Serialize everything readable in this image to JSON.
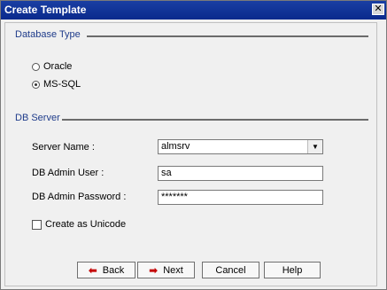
{
  "window": {
    "title": "Create Template",
    "close_glyph": "✕"
  },
  "database_type": {
    "label": "Database Type",
    "options": [
      {
        "label": "Oracle",
        "selected": false
      },
      {
        "label": "MS-SQL",
        "selected": true
      }
    ]
  },
  "db_server": {
    "label": "DB Server",
    "fields": {
      "server_name": {
        "label": "Server Name :",
        "value": "almsrv"
      },
      "admin_user": {
        "label": "DB Admin User :",
        "value": "sa"
      },
      "admin_password": {
        "label": "DB Admin Password :",
        "value": "*******"
      }
    },
    "unicode_checkbox": {
      "label": "Create as Unicode",
      "checked": false
    }
  },
  "buttons": {
    "back": {
      "label": "Back",
      "icon": "left-arrow-icon"
    },
    "next": {
      "label": "Next",
      "icon": "right-arrow-icon"
    },
    "cancel": {
      "label": "Cancel"
    },
    "help": {
      "label": "Help"
    }
  },
  "colors": {
    "titlebar": "#0a2a8c",
    "section_label": "#1e3b8a",
    "arrow": "#c40000"
  }
}
